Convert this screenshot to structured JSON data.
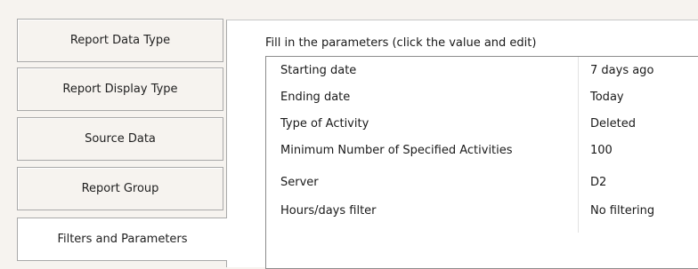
{
  "sidebar": {
    "items": [
      {
        "label": "Report Data Type"
      },
      {
        "label": "Report Display Type"
      },
      {
        "label": "Source Data"
      },
      {
        "label": "Report Group"
      },
      {
        "label": "Filters and Parameters",
        "active": true
      }
    ]
  },
  "panel": {
    "instructions": "Fill in the parameters (click the value and edit)",
    "rows": [
      {
        "name": "Starting date",
        "value": "7 days ago"
      },
      {
        "name": "Ending date",
        "value": "Today"
      },
      {
        "name": "Type of Activity",
        "value": "Deleted"
      },
      {
        "name": "Minimum Number of Specified Activities",
        "value": "100"
      },
      {
        "name": "Server",
        "value": "D2"
      },
      {
        "name": "Hours/days filter",
        "value": "No filtering"
      }
    ]
  }
}
